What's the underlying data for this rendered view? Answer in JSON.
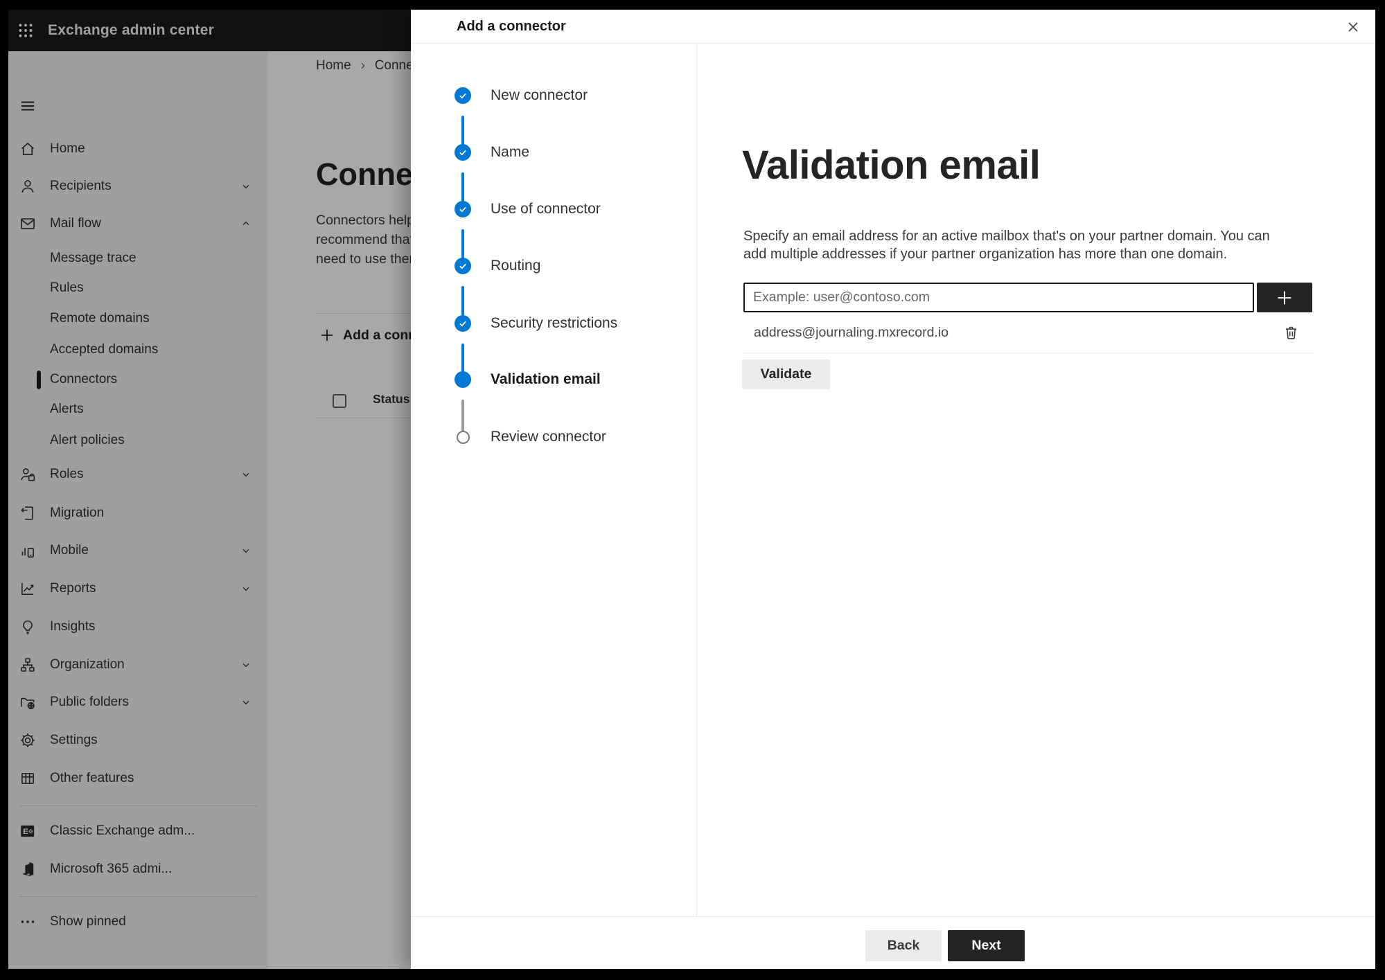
{
  "topbar": {
    "title": "Exchange admin center"
  },
  "sidebar": {
    "items": [
      {
        "label": "Home",
        "icon": "home-icon"
      },
      {
        "label": "Recipients",
        "icon": "person-icon",
        "chevron": "down"
      },
      {
        "label": "Mail flow",
        "icon": "mail-icon",
        "chevron": "up",
        "expanded": true
      },
      {
        "label": "Message trace",
        "indent": true
      },
      {
        "label": "Rules",
        "indent": true
      },
      {
        "label": "Remote domains",
        "indent": true
      },
      {
        "label": "Accepted domains",
        "indent": true
      },
      {
        "label": "Connectors",
        "indent": true,
        "selected": true
      },
      {
        "label": "Alerts",
        "indent": true
      },
      {
        "label": "Alert policies",
        "indent": true
      },
      {
        "label": "Roles",
        "icon": "roles-icon",
        "chevron": "down"
      },
      {
        "label": "Migration",
        "icon": "migration-icon"
      },
      {
        "label": "Mobile",
        "icon": "mobile-icon",
        "chevron": "down"
      },
      {
        "label": "Reports",
        "icon": "reports-icon",
        "chevron": "down"
      },
      {
        "label": "Insights",
        "icon": "lightbulb-icon"
      },
      {
        "label": "Organization",
        "icon": "org-chart-icon",
        "chevron": "down"
      },
      {
        "label": "Public folders",
        "icon": "folder-globe-icon",
        "chevron": "down"
      },
      {
        "label": "Settings",
        "icon": "gear-icon"
      },
      {
        "label": "Other features",
        "icon": "table-grid-icon"
      },
      {
        "label": "Classic Exchange adm...",
        "icon": "classic-exchange-icon"
      },
      {
        "label": "Microsoft 365 admi...",
        "icon": "m365-icon"
      },
      {
        "label": "Show pinned",
        "icon": "ellipsis-icon"
      }
    ]
  },
  "page": {
    "breadcrumb": {
      "home": "Home",
      "current": "Connectors"
    },
    "title": "Connectors",
    "description_lines": [
      "Connectors help",
      "recommend that",
      "need to use them"
    ],
    "add_button": "Add a connector",
    "table": {
      "status_header": "Status"
    }
  },
  "dialog": {
    "title": "Add a connector",
    "steps": [
      {
        "label": "New connector",
        "state": "completed"
      },
      {
        "label": "Name",
        "state": "completed"
      },
      {
        "label": "Use of connector",
        "state": "completed"
      },
      {
        "label": "Routing",
        "state": "completed"
      },
      {
        "label": "Security restrictions",
        "state": "completed"
      },
      {
        "label": "Validation email",
        "state": "current"
      },
      {
        "label": "Review connector",
        "state": "upcoming"
      }
    ],
    "content": {
      "heading": "Validation email",
      "description": "Specify an email address for an active mailbox that's on your partner domain. You can add multiple addresses if your partner organization has more than one domain.",
      "email_input": {
        "value": "",
        "placeholder": "Example: user@contoso.com"
      },
      "addresses": [
        {
          "email": "address@journaling.mxrecord.io"
        }
      ],
      "validate_button": "Validate"
    },
    "footer": {
      "back_button": "Back",
      "next_button": "Next"
    }
  },
  "icons": {
    "waffle": "apps-grid-icon",
    "hamburger": "menu-icon",
    "close": "close-icon",
    "plus": "plus-icon",
    "trash": "delete-icon",
    "step_done": "checkmark-icon",
    "breadcrumb_sep": "chevron-right-icon"
  },
  "colors": {
    "accent": "#0078d4",
    "topbar_bg": "#1a1a19",
    "nav_bg": "#f3f2f1",
    "dark_button": "#252423",
    "light_button": "#edebe9",
    "text": "#323130",
    "divider": "#eceae8",
    "step_upcoming_gray": "#7a7a7a"
  }
}
